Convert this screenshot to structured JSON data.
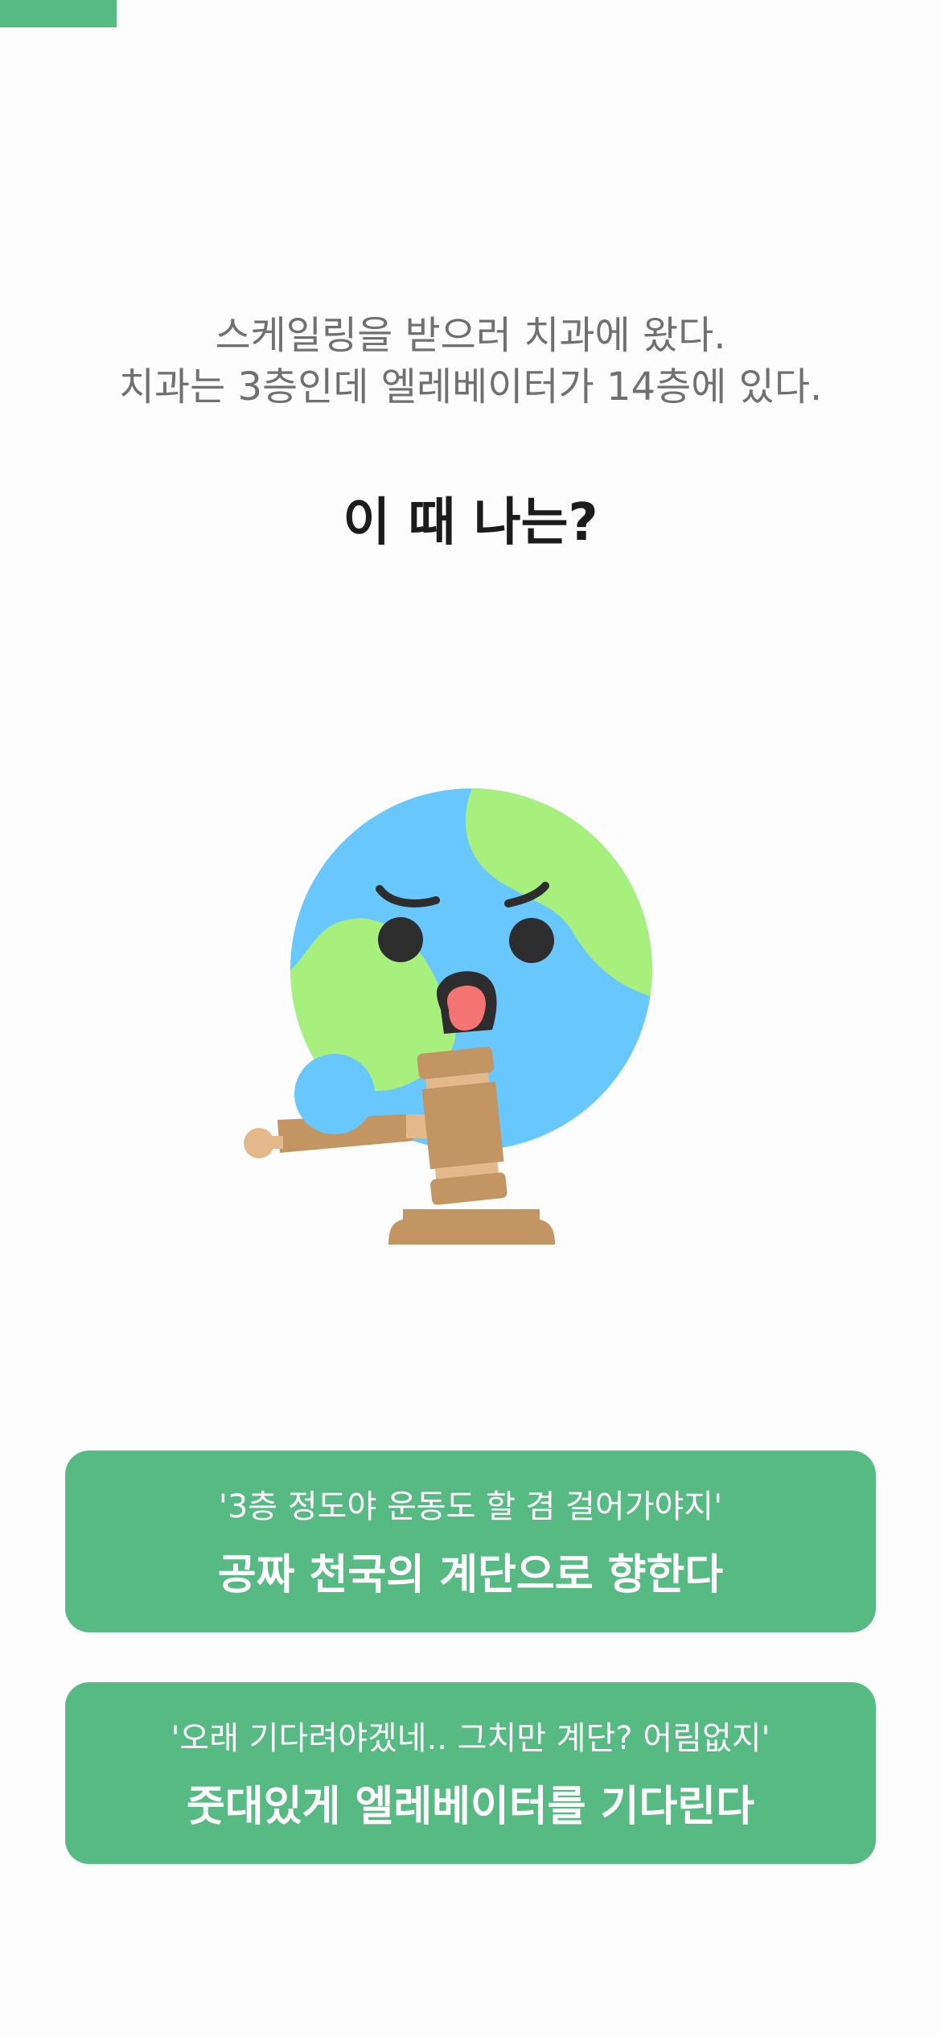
{
  "progress": {
    "fraction": 0.124,
    "color": "#58ba83"
  },
  "question": {
    "line1": "스케일링을 받으러 치과에 왔다.",
    "line2": "치과는 3층인데 엘레베이터가 14층에 있다."
  },
  "prompt": "이 때 나는?",
  "illustration": {
    "icon": "earth-character-with-gavel-icon",
    "colors": {
      "ocean": "#68c7fc",
      "land": "#a8f07d",
      "face": "#2d2d2d",
      "tongue": "#f47373",
      "wood": "#c39562",
      "wood_light": "#e3b98b"
    }
  },
  "choices": [
    {
      "quote": "'3층 정도야 운동도 할 겸 걸어가야지'",
      "action": "공짜 천국의 계단으로 향한다"
    },
    {
      "quote": "'오래 기다려야겠네.. 그치만 계단? 어림없지'",
      "action": "줏대있게 엘레베이터를 기다린다"
    }
  ],
  "accent_color": "#58ba83"
}
